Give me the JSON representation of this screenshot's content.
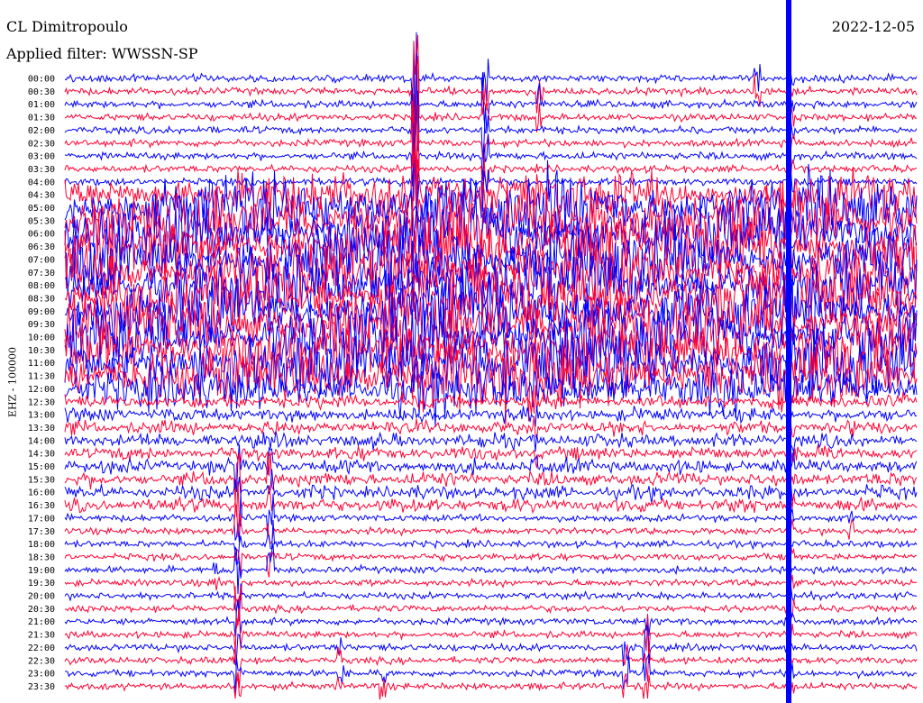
{
  "header": {
    "station": "CL Dimitropoulo",
    "filter": "Applied filter: WWSSN-SP",
    "date": "2022-12-05"
  },
  "channel_label": "EHZ - 100000",
  "colors": {
    "trace_a": "#0000ff",
    "trace_b": "#ff0033",
    "background": "#ffffff"
  },
  "chart_data": {
    "type": "line",
    "title": "CL Dimitropoulo",
    "subtitle": "Applied filter: WWSSN-SP",
    "ylabel": "EHZ - 100000",
    "row_labels": [
      "00:00",
      "00:30",
      "01:00",
      "01:30",
      "02:00",
      "02:30",
      "03:00",
      "03:30",
      "04:00",
      "04:30",
      "05:00",
      "05:30",
      "06:00",
      "06:30",
      "07:00",
      "07:30",
      "08:00",
      "08:30",
      "09:00",
      "09:30",
      "10:00",
      "10:30",
      "11:00",
      "11:30",
      "12:00",
      "12:30",
      "13:00",
      "13:30",
      "14:00",
      "14:30",
      "15:00",
      "15:30",
      "16:00",
      "16:30",
      "17:00",
      "17:30",
      "18:00",
      "18:30",
      "19:00",
      "19:30",
      "20:00",
      "20:30",
      "21:00",
      "21:30",
      "22:00",
      "22:30",
      "23:00",
      "23:30"
    ],
    "series": [
      {
        "name": "EHZ",
        "color": "#0000ff"
      },
      {
        "name": "EHZ",
        "color": "#ff0033"
      }
    ],
    "row_minutes": 30,
    "grid": false
  }
}
